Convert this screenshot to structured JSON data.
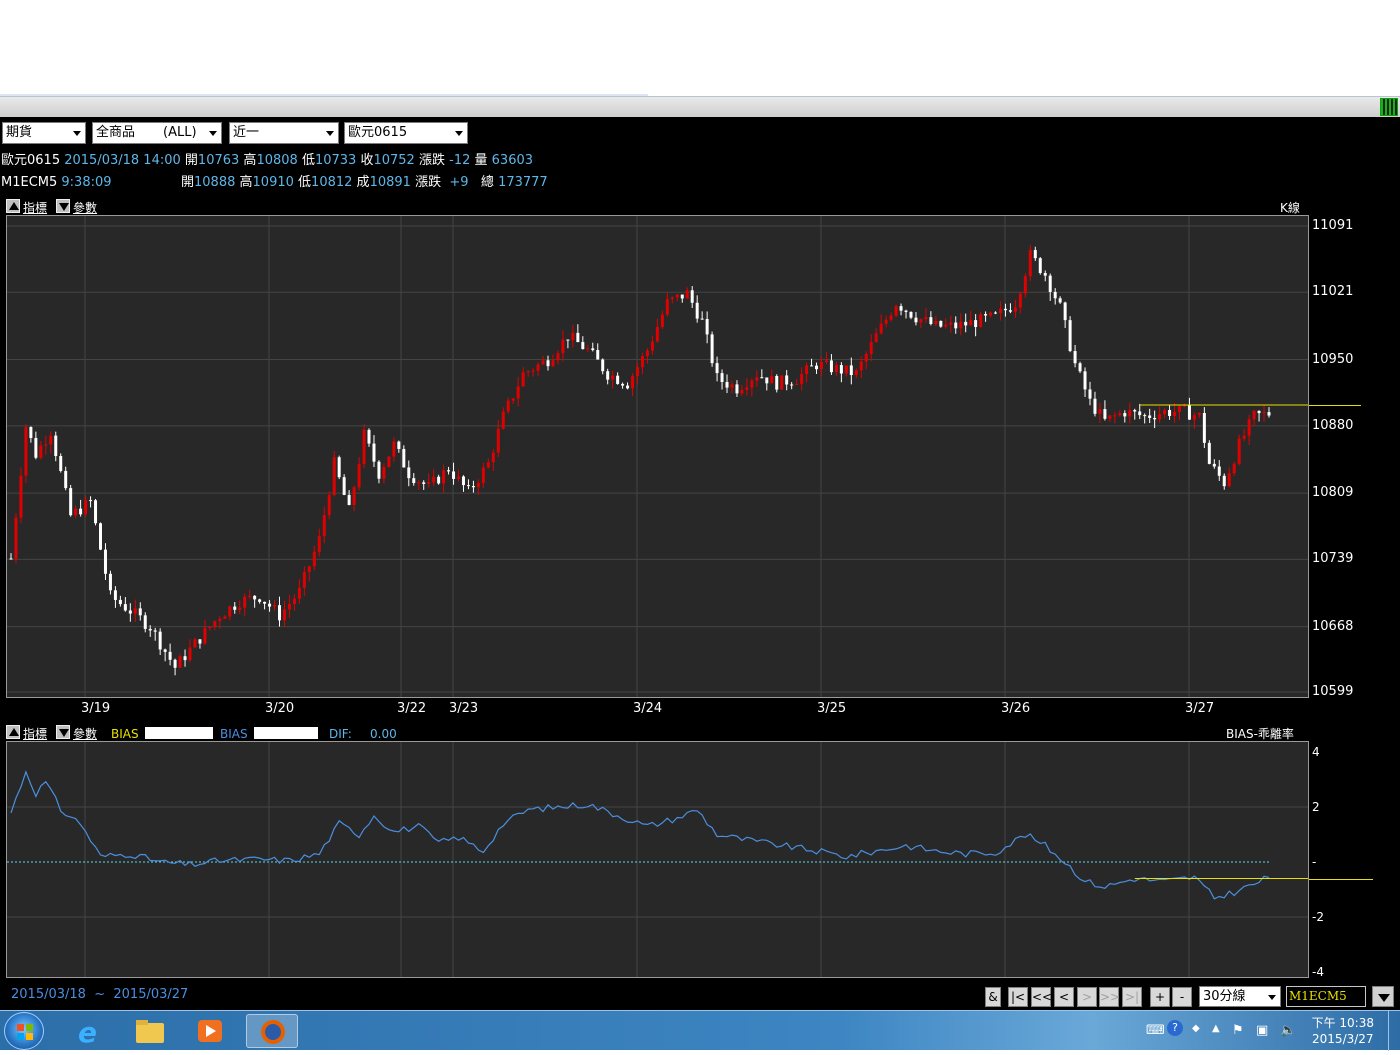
{
  "toolbar": {
    "market": "期貨",
    "product": "全商品",
    "product_filter": "(ALL)",
    "period": "近一",
    "contract": "歐元0615"
  },
  "quote_row1": {
    "name": "歐元0615",
    "datetime": "2015/03/18 14:00",
    "open_label": "開",
    "open": "10763",
    "high_label": "高",
    "high": "10808",
    "low_label": "低",
    "low": "10733",
    "close_label": "收",
    "close": "10752",
    "change_label": "漲跌",
    "change": "-12",
    "volume_label": "量",
    "volume": "63603"
  },
  "quote_row2": {
    "name": "M1ECM5",
    "time": "9:38:09",
    "open_label": "開",
    "open": "10888",
    "high_label": "高",
    "high": "10910",
    "low_label": "低",
    "low": "10812",
    "trade_label": "成",
    "trade": "10891",
    "change_label": "漲跌",
    "change": "+9",
    "total_label": "總",
    "total": "173777"
  },
  "main_chart_header": {
    "indicator_label": "指標",
    "param_label": "參數",
    "chart_name": "K線"
  },
  "sub_chart_header": {
    "indicator_label": "指標",
    "param_label": "參數",
    "bias1_label": "BIAS",
    "bias2_label": "BIAS",
    "dif_label": "DIF:",
    "dif_value": "0.00",
    "chart_name": "BIAS-乖離率"
  },
  "chart_data": [
    {
      "type": "candlestick",
      "title": "K線",
      "y_ticks": [
        11091,
        11021,
        10950,
        10880,
        10809,
        10739,
        10668,
        10599
      ],
      "ylim": [
        10599,
        11091
      ],
      "x_labels": [
        "3/19",
        "3/20",
        "3/22",
        "3/23",
        "3/24",
        "3/25",
        "3/26",
        "3/27"
      ],
      "reference_line": 10902,
      "close_path": [
        {
          "t": 0,
          "v": 10740
        },
        {
          "t": 3,
          "v": 10880
        },
        {
          "t": 5,
          "v": 10850
        },
        {
          "t": 8,
          "v": 10875
        },
        {
          "t": 12,
          "v": 10785
        },
        {
          "t": 16,
          "v": 10800
        },
        {
          "t": 20,
          "v": 10700
        },
        {
          "t": 24,
          "v": 10685
        },
        {
          "t": 28,
          "v": 10668
        },
        {
          "t": 33,
          "v": 10625
        },
        {
          "t": 37,
          "v": 10650
        },
        {
          "t": 42,
          "v": 10680
        },
        {
          "t": 46,
          "v": 10695
        },
        {
          "t": 50,
          "v": 10700
        },
        {
          "t": 54,
          "v": 10680
        },
        {
          "t": 58,
          "v": 10705
        },
        {
          "t": 62,
          "v": 10760
        },
        {
          "t": 65,
          "v": 10840
        },
        {
          "t": 68,
          "v": 10790
        },
        {
          "t": 71,
          "v": 10870
        },
        {
          "t": 74,
          "v": 10830
        },
        {
          "t": 77,
          "v": 10860
        },
        {
          "t": 80,
          "v": 10830
        },
        {
          "t": 84,
          "v": 10815
        },
        {
          "t": 88,
          "v": 10835
        },
        {
          "t": 92,
          "v": 10810
        },
        {
          "t": 96,
          "v": 10840
        },
        {
          "t": 99,
          "v": 10890
        },
        {
          "t": 103,
          "v": 10935
        },
        {
          "t": 108,
          "v": 10950
        },
        {
          "t": 112,
          "v": 10975
        },
        {
          "t": 116,
          "v": 10960
        },
        {
          "t": 120,
          "v": 10935
        },
        {
          "t": 124,
          "v": 10925
        },
        {
          "t": 128,
          "v": 10960
        },
        {
          "t": 132,
          "v": 11010
        },
        {
          "t": 136,
          "v": 11020
        },
        {
          "t": 139,
          "v": 10990
        },
        {
          "t": 142,
          "v": 10930
        },
        {
          "t": 146,
          "v": 10920
        },
        {
          "t": 150,
          "v": 10935
        },
        {
          "t": 154,
          "v": 10925
        },
        {
          "t": 158,
          "v": 10930
        },
        {
          "t": 162,
          "v": 10945
        },
        {
          "t": 166,
          "v": 10940
        },
        {
          "t": 170,
          "v": 10935
        },
        {
          "t": 174,
          "v": 10975
        },
        {
          "t": 178,
          "v": 11010
        },
        {
          "t": 182,
          "v": 10995
        },
        {
          "t": 186,
          "v": 10985
        },
        {
          "t": 190,
          "v": 10985
        },
        {
          "t": 194,
          "v": 10990
        },
        {
          "t": 198,
          "v": 10995
        },
        {
          "t": 202,
          "v": 11010
        },
        {
          "t": 205,
          "v": 11060
        },
        {
          "t": 208,
          "v": 11040
        },
        {
          "t": 211,
          "v": 11005
        },
        {
          "t": 214,
          "v": 10945
        },
        {
          "t": 217,
          "v": 10905
        },
        {
          "t": 220,
          "v": 10885
        },
        {
          "t": 224,
          "v": 10895
        },
        {
          "t": 228,
          "v": 10890
        },
        {
          "t": 232,
          "v": 10895
        },
        {
          "t": 236,
          "v": 10895
        },
        {
          "t": 239,
          "v": 10890
        },
        {
          "t": 241,
          "v": 10840
        },
        {
          "t": 244,
          "v": 10820
        },
        {
          "t": 247,
          "v": 10860
        },
        {
          "t": 250,
          "v": 10890
        },
        {
          "t": 253,
          "v": 10893
        }
      ]
    },
    {
      "type": "line",
      "title": "BIAS-乖離率",
      "y_ticks": [
        "4",
        "2",
        "-",
        "-2",
        "-4"
      ],
      "ylim": [
        -4,
        4
      ],
      "zero_line": 0,
      "reference_line": -0.6,
      "series": [
        {
          "values": [
            {
              "t": 0,
              "v": 1.8
            },
            {
              "t": 3,
              "v": 3.3
            },
            {
              "t": 5,
              "v": 2.5
            },
            {
              "t": 7,
              "v": 2.9
            },
            {
              "t": 10,
              "v": 1.9
            },
            {
              "t": 14,
              "v": 1.4
            },
            {
              "t": 18,
              "v": 0.2
            },
            {
              "t": 24,
              "v": 0.3
            },
            {
              "t": 30,
              "v": 0.0
            },
            {
              "t": 36,
              "v": -0.1
            },
            {
              "t": 42,
              "v": 0.05
            },
            {
              "t": 50,
              "v": 0.1
            },
            {
              "t": 56,
              "v": 0.05
            },
            {
              "t": 62,
              "v": 0.3
            },
            {
              "t": 66,
              "v": 1.4
            },
            {
              "t": 70,
              "v": 1.0
            },
            {
              "t": 73,
              "v": 1.7
            },
            {
              "t": 77,
              "v": 1.1
            },
            {
              "t": 82,
              "v": 1.3
            },
            {
              "t": 86,
              "v": 0.7
            },
            {
              "t": 90,
              "v": 0.9
            },
            {
              "t": 95,
              "v": 0.4
            },
            {
              "t": 99,
              "v": 1.4
            },
            {
              "t": 104,
              "v": 1.9
            },
            {
              "t": 110,
              "v": 2.0
            },
            {
              "t": 116,
              "v": 2.1
            },
            {
              "t": 122,
              "v": 1.7
            },
            {
              "t": 128,
              "v": 1.3
            },
            {
              "t": 134,
              "v": 1.6
            },
            {
              "t": 138,
              "v": 1.9
            },
            {
              "t": 142,
              "v": 1.0
            },
            {
              "t": 148,
              "v": 0.8
            },
            {
              "t": 155,
              "v": 0.6
            },
            {
              "t": 162,
              "v": 0.4
            },
            {
              "t": 168,
              "v": 0.2
            },
            {
              "t": 174,
              "v": 0.4
            },
            {
              "t": 180,
              "v": 0.6
            },
            {
              "t": 186,
              "v": 0.4
            },
            {
              "t": 192,
              "v": 0.3
            },
            {
              "t": 198,
              "v": 0.35
            },
            {
              "t": 204,
              "v": 1.0
            },
            {
              "t": 208,
              "v": 0.6
            },
            {
              "t": 212,
              "v": 0.0
            },
            {
              "t": 216,
              "v": -0.7
            },
            {
              "t": 220,
              "v": -0.9
            },
            {
              "t": 226,
              "v": -0.6
            },
            {
              "t": 232,
              "v": -0.7
            },
            {
              "t": 238,
              "v": -0.55
            },
            {
              "t": 242,
              "v": -1.3
            },
            {
              "t": 246,
              "v": -1.1
            },
            {
              "t": 250,
              "v": -0.8
            },
            {
              "t": 253,
              "v": -0.55
            }
          ]
        }
      ]
    }
  ],
  "footer": {
    "date_from": "2015/03/18",
    "tilde": "~",
    "date_to": "2015/03/27",
    "interval": "30分線",
    "symbol": "M1ECM5"
  },
  "nav_buttons": [
    "&",
    "|<",
    "<<",
    "<",
    ">",
    ">>",
    ">|",
    "+",
    "-"
  ],
  "taskbar": {
    "time": "下午 10:38",
    "date": "2015/3/27"
  },
  "colors": {
    "up": "#e00000",
    "down": "#ffffff",
    "cyan": "#5fb6e8",
    "bias": "#4a8fe0",
    "reference": "#e8e000",
    "grid": "#444444",
    "panel": "#282828"
  }
}
